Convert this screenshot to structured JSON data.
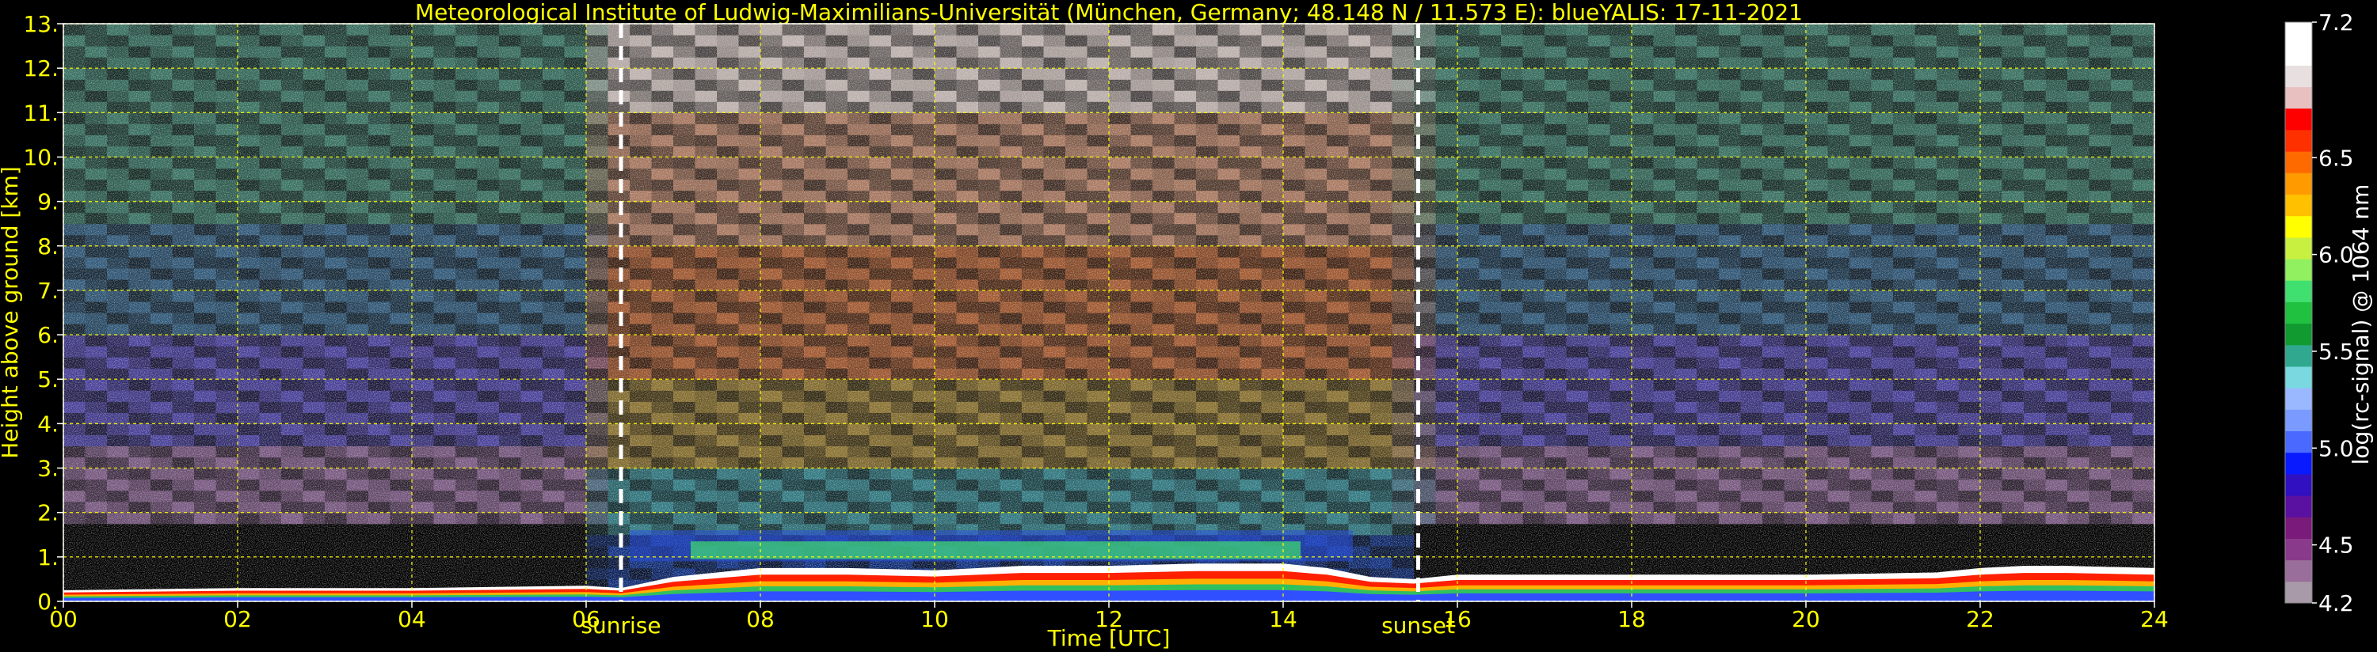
{
  "chart_data": {
    "type": "heatmap",
    "title": "Meteorological Institute of Ludwig-Maximilians-Universität (München, Germany; 48.148 N / 11.573 E):    blueYALIS: 17-11-2021",
    "xlabel": "Time [UTC]",
    "ylabel": "Height above ground [km]",
    "xlim": [
      0,
      24
    ],
    "ylim": [
      0,
      13
    ],
    "x_ticks": [
      "00",
      "02",
      "04",
      "06",
      "08",
      "10",
      "12",
      "14",
      "16",
      "18",
      "20",
      "22",
      "24"
    ],
    "x_tick_values": [
      0,
      2,
      4,
      6,
      8,
      10,
      12,
      14,
      16,
      18,
      20,
      22,
      24
    ],
    "y_ticks": [
      "0.",
      "1.",
      "2.",
      "3.",
      "4.",
      "5.",
      "6.",
      "7.",
      "8.",
      "9.",
      "10.",
      "11.",
      "12.",
      "13."
    ],
    "y_tick_values": [
      0,
      1,
      2,
      3,
      4,
      5,
      6,
      7,
      8,
      9,
      10,
      11,
      12,
      13
    ],
    "grid": true,
    "grid_color": "#ffff00",
    "events": [
      {
        "label": "sunrise",
        "x": 6.4
      },
      {
        "label": "sunset",
        "x": 15.55
      }
    ],
    "colorbar": {
      "label": "log(rc-signal) @ 1064 nm",
      "range": [
        4.2,
        7.2
      ],
      "tick_labels": [
        "4.2",
        "4.5",
        "5.0",
        "5.5",
        "6.0",
        "6.5",
        "7.2"
      ],
      "tick_values": [
        4.2,
        4.5,
        5.0,
        5.5,
        6.0,
        6.5,
        7.2
      ],
      "colors": [
        "#a89aa8",
        "#9a6e9a",
        "#8a3a8a",
        "#7a1a7a",
        "#5a10a0",
        "#3010c0",
        "#0a1aff",
        "#4a6aff",
        "#7a9aff",
        "#9ab8ff",
        "#7ad8e0",
        "#30a890",
        "#109a30",
        "#20c040",
        "#40e070",
        "#90f060",
        "#c8f040",
        "#ffff00",
        "#ffc000",
        "#ff9a00",
        "#ff6a00",
        "#ff3000",
        "#ff0000",
        "#e8c0c0",
        "#e8e0e0",
        "#ffffff",
        "#ffffff"
      ]
    },
    "profile_samples": {
      "note_hours": [
        0,
        2,
        4,
        6,
        6.4,
        7,
        8,
        9,
        10,
        11,
        12,
        13,
        14,
        14.5,
        15,
        15.5,
        16,
        18,
        20,
        21.5,
        22,
        22.5,
        23,
        24
      ],
      "aerosol_layer_top_km": [
        0.25,
        0.3,
        0.3,
        0.35,
        0.3,
        0.55,
        0.75,
        0.75,
        0.7,
        0.8,
        0.8,
        0.85,
        0.85,
        0.75,
        0.55,
        0.5,
        0.6,
        0.6,
        0.6,
        0.65,
        0.75,
        0.8,
        0.8,
        0.75
      ]
    }
  }
}
